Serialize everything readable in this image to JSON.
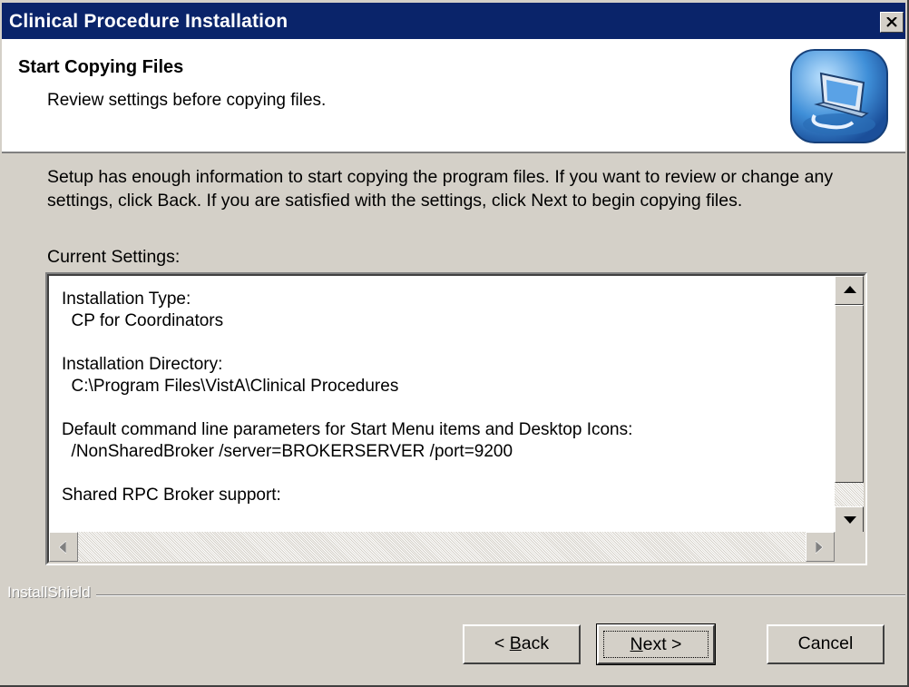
{
  "window": {
    "title": "Clinical Procedure Installation",
    "close_label": "✕"
  },
  "header": {
    "title": "Start Copying Files",
    "subtitle": "Review settings before copying files."
  },
  "body": {
    "description": "Setup has enough information to start copying the program files.  If you want to review or change any settings, click Back.  If you are satisfied with the settings, click Next to begin copying files.",
    "settings_label": "Current Settings:",
    "settings_lines": [
      "Installation Type:",
      "  CP for Coordinators",
      "",
      "Installation Directory:",
      "  C:\\Program Files\\VistA\\Clinical Procedures",
      "",
      "Default command line parameters for Start Menu items and Desktop Icons:",
      "  /NonSharedBroker /server=BROKERSERVER /port=9200",
      "",
      "Shared RPC Broker support:"
    ]
  },
  "footer": {
    "brand": "InstallShield",
    "back": {
      "prefix": "< ",
      "mnemonic": "B",
      "rest": "ack"
    },
    "next": {
      "mnemonic": "N",
      "rest": "ext >"
    },
    "cancel": "Cancel"
  },
  "colors": {
    "titlebar": "#0a246a",
    "face": "#d4d0c8"
  }
}
